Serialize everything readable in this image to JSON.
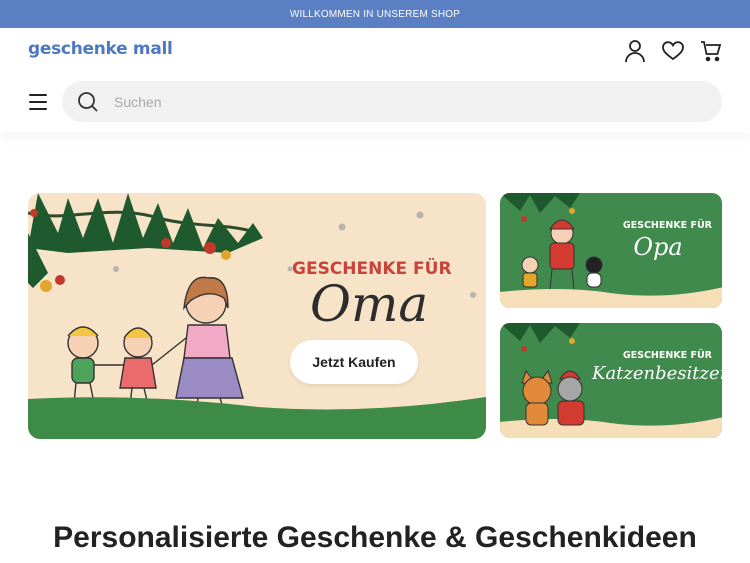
{
  "announcement": "WILLKOMMEN IN UNSEREM SHOP",
  "header": {
    "logo": "geschenke mall",
    "icons": [
      "user-icon",
      "heart-icon",
      "cart-icon"
    ]
  },
  "search": {
    "placeholder": "Suchen"
  },
  "hero": {
    "title": "GESCHENKE FÜR",
    "name": "Oma",
    "button": "Jetzt Kaufen"
  },
  "cards": [
    {
      "title": "GESCHENKE FÜR",
      "name": "Opa"
    },
    {
      "title": "GESCHENKE FÜR",
      "name": "Katzenbesitzer"
    }
  ],
  "section": {
    "title": "Personalisierte Geschenke & Geschenkideen"
  },
  "colors": {
    "topbar": "#5b7fc3",
    "brand": "#4d79c2",
    "green": "#3d8b46",
    "cream": "#f7e3c7",
    "red_title": "#c8433a"
  }
}
